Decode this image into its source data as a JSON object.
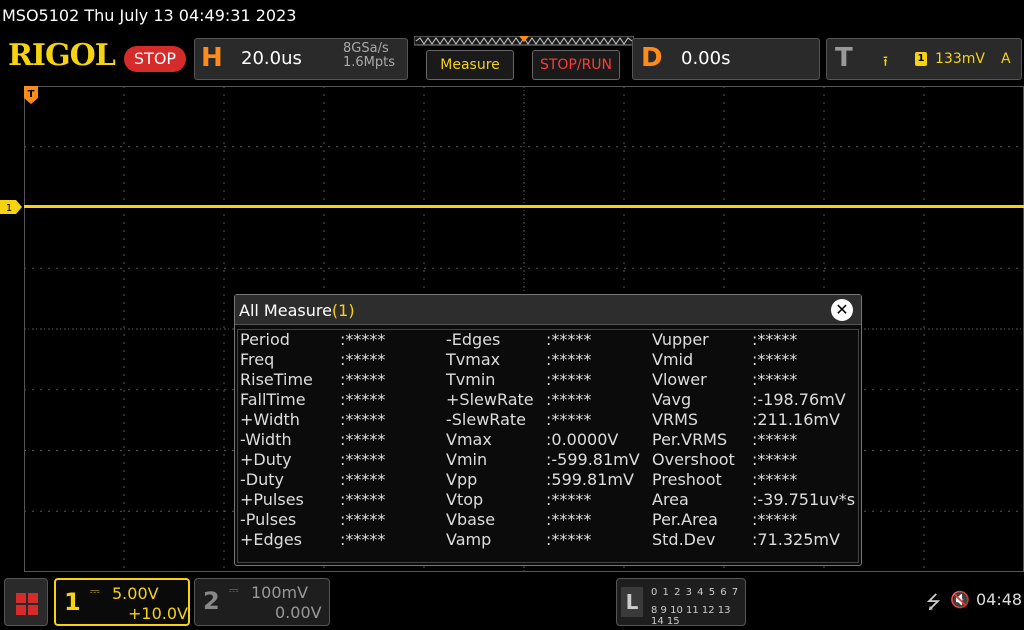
{
  "title_bar": {
    "text": "MSO5102  Thu July 13 04:49:31 2023"
  },
  "top_bar": {
    "logo": "RIGOL",
    "run_state": "STOP",
    "horizontal": {
      "letter": "H",
      "timebase": "20.0us",
      "sample_rate": "8GSa/s",
      "memory_depth": "1.6Mpts"
    },
    "measure_button": "Measure",
    "stop_run_button": "STOP/RUN",
    "delay": {
      "letter": "D",
      "value": "0.00s"
    },
    "trigger": {
      "letter": "T",
      "edge_icon": "rising-edge-icon",
      "source": "1",
      "level": "133mV",
      "mode": "A"
    }
  },
  "screen": {
    "ch1_marker": "1",
    "colors": {
      "ch1": "#f5d311",
      "grid": "#555555",
      "trigger": "#ff8c1a"
    }
  },
  "measure_panel": {
    "title": "All Measure",
    "channel": "(1)",
    "rows": [
      [
        {
          "n": "Period",
          "v": ":*****"
        },
        {
          "n": "-Edges",
          "v": ":*****"
        },
        {
          "n": "Vupper",
          "v": ":*****"
        }
      ],
      [
        {
          "n": "Freq",
          "v": ":*****"
        },
        {
          "n": "Tvmax",
          "v": ":*****"
        },
        {
          "n": "Vmid",
          "v": ":*****"
        }
      ],
      [
        {
          "n": "RiseTime",
          "v": ":*****"
        },
        {
          "n": "Tvmin",
          "v": ":*****"
        },
        {
          "n": "Vlower",
          "v": ":*****"
        }
      ],
      [
        {
          "n": "FallTime",
          "v": ":*****"
        },
        {
          "n": "+SlewRate",
          "v": ":*****"
        },
        {
          "n": "Vavg",
          "v": ":-198.76mV"
        }
      ],
      [
        {
          "n": "+Width",
          "v": ":*****"
        },
        {
          "n": "-SlewRate",
          "v": ":*****"
        },
        {
          "n": "VRMS",
          "v": ":211.16mV"
        }
      ],
      [
        {
          "n": "-Width",
          "v": ":*****"
        },
        {
          "n": "Vmax",
          "v": ":0.0000V"
        },
        {
          "n": "Per.VRMS",
          "v": ":*****"
        }
      ],
      [
        {
          "n": "+Duty",
          "v": ":*****"
        },
        {
          "n": "Vmin",
          "v": ":-599.81mV"
        },
        {
          "n": "Overshoot",
          "v": ":*****"
        }
      ],
      [
        {
          "n": "-Duty",
          "v": ":*****"
        },
        {
          "n": "Vpp",
          "v": ":599.81mV"
        },
        {
          "n": "Preshoot",
          "v": ":*****"
        }
      ],
      [
        {
          "n": "+Pulses",
          "v": ":*****"
        },
        {
          "n": "Vtop",
          "v": ":*****"
        },
        {
          "n": "Area",
          "v": ":-39.751uv*s"
        }
      ],
      [
        {
          "n": "-Pulses",
          "v": ":*****"
        },
        {
          "n": "Vbase",
          "v": ":*****"
        },
        {
          "n": "Per.Area",
          "v": ":*****"
        }
      ],
      [
        {
          "n": "+Edges",
          "v": ":*****"
        },
        {
          "n": "Vamp",
          "v": ":*****"
        },
        {
          "n": "Std.Dev",
          "v": ":71.325mV"
        }
      ]
    ]
  },
  "bottom_bar": {
    "ch1": {
      "number": "1",
      "scale": "5.00V",
      "offset": "+10.0V"
    },
    "ch2": {
      "number": "2",
      "scale": "100mV",
      "offset": "0.00V"
    },
    "logic": {
      "letter": "L",
      "row1": "0 1 2 3  4 5 6 7",
      "row2": "8 9 10 11 12 13 14 15"
    },
    "clock": "04:48"
  }
}
